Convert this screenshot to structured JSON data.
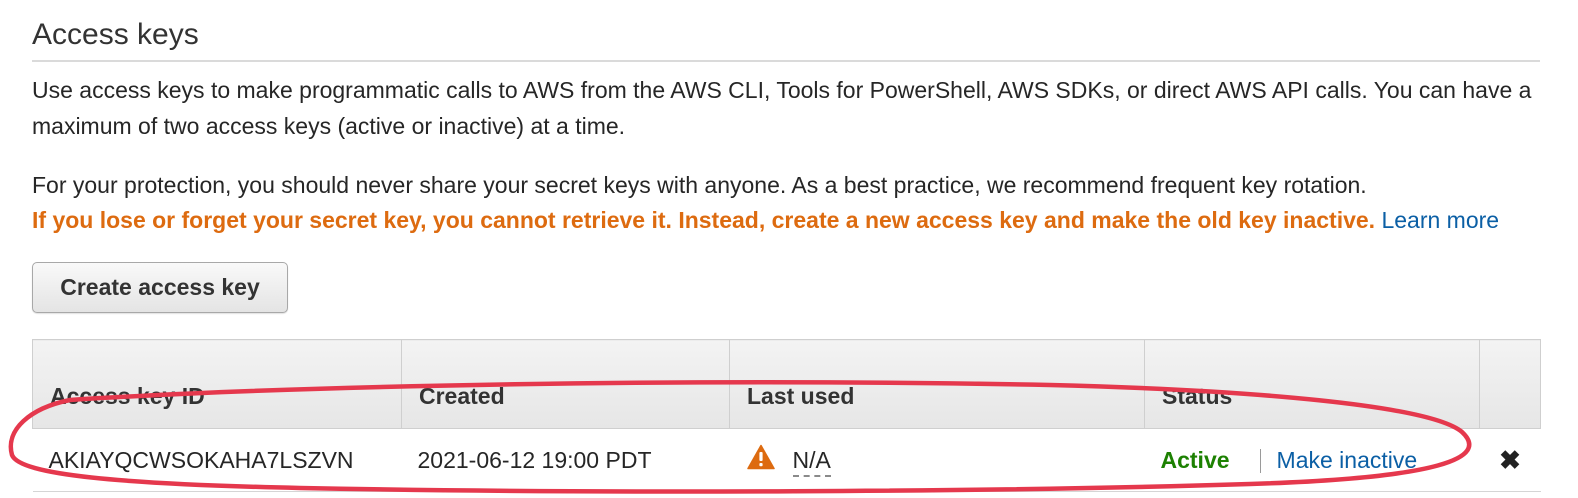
{
  "section": {
    "title": "Access keys",
    "description": "Use access keys to make programmatic calls to AWS from the AWS CLI, Tools for PowerShell, AWS SDKs, or direct AWS API calls. You can have a maximum of two access keys (active or inactive) at a time.",
    "protection_text": "For your protection, you should never share your secret keys with anyone. As a best practice, we recommend frequent key rotation.",
    "warning_text": "If you lose or forget your secret key, you cannot retrieve it. Instead, create a new access key and make the old key inactive.",
    "learn_more_label": "Learn more"
  },
  "create_button_label": "Create access key",
  "table": {
    "headers": {
      "access_key_id": "Access key ID",
      "created": "Created",
      "last_used": "Last used",
      "status": "Status"
    },
    "rows": [
      {
        "access_key_id": "AKIAYQCWSOKAHA7LSZVN",
        "created": "2021-06-12 19:00 PDT",
        "last_used": "N/A",
        "last_used_icon": "warning-triangle-icon",
        "status": "Active",
        "action_label": "Make inactive",
        "delete_icon": "close-icon"
      }
    ]
  },
  "colors": {
    "warning_orange": "#dd6b10",
    "link_blue": "#0b5fa5",
    "active_green": "#1d8102",
    "annotation_red": "#e5384d"
  }
}
